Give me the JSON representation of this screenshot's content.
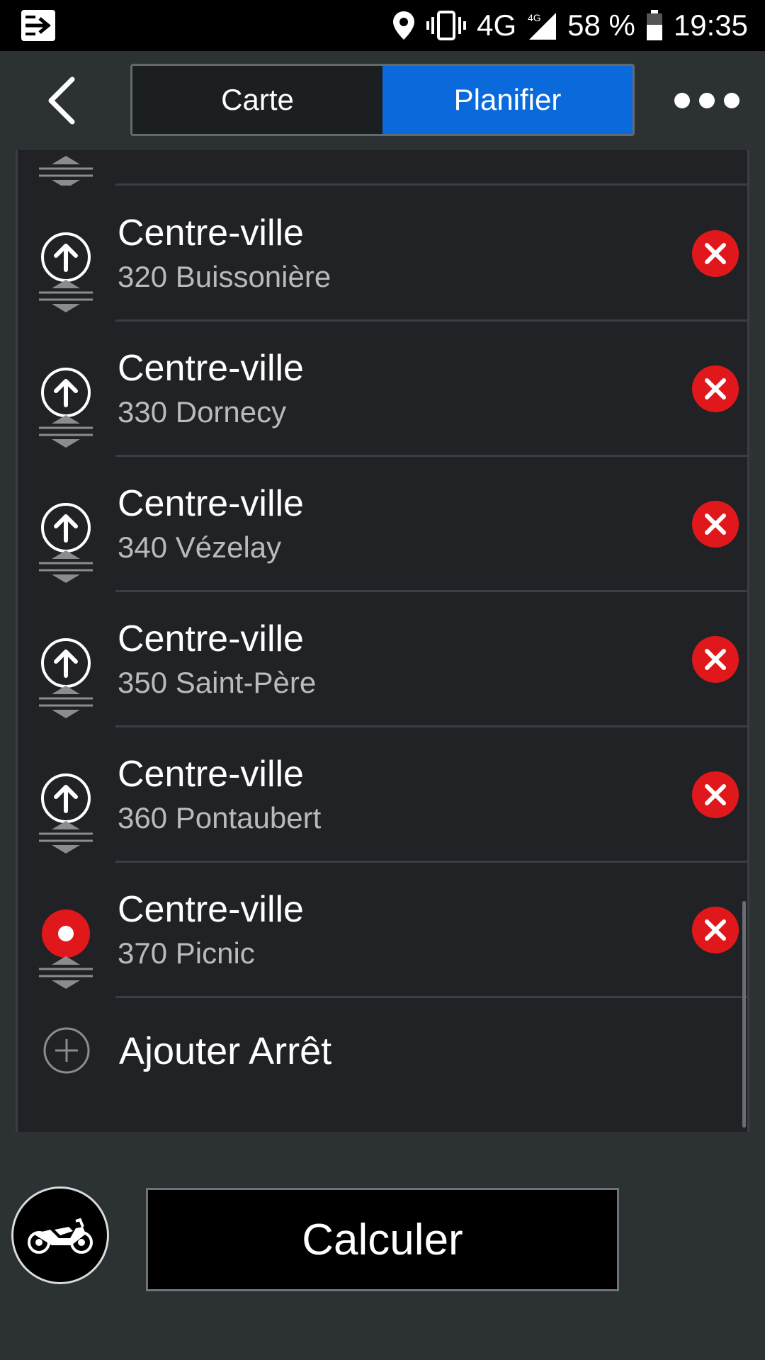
{
  "status_bar": {
    "network": "4G",
    "network_small": "4G",
    "battery": "58 %",
    "time": "19:35",
    "icons": [
      "notification-app-icon",
      "location-icon",
      "vibrate-icon",
      "signal-icon",
      "battery-icon"
    ]
  },
  "header": {
    "tabs": [
      {
        "label": "Carte",
        "active": false
      },
      {
        "label": "Planifier",
        "active": true
      }
    ],
    "accent_color": "#0a6adb"
  },
  "stops": [
    {
      "title": "Centre-ville",
      "subtitle": "320 Buissonière",
      "type": "waypoint"
    },
    {
      "title": "Centre-ville",
      "subtitle": "330 Dornecy",
      "type": "waypoint"
    },
    {
      "title": "Centre-ville",
      "subtitle": "340 Vézelay",
      "type": "waypoint"
    },
    {
      "title": "Centre-ville",
      "subtitle": "350 Saint-Père",
      "type": "waypoint"
    },
    {
      "title": "Centre-ville",
      "subtitle": "360 Pontaubert",
      "type": "waypoint"
    },
    {
      "title": "Centre-ville",
      "subtitle": "370 Picnic",
      "type": "destination"
    }
  ],
  "add_stop_label": "Ajouter Arrêt",
  "calculate_label": "Calculer",
  "delete_color": "#e0181b"
}
